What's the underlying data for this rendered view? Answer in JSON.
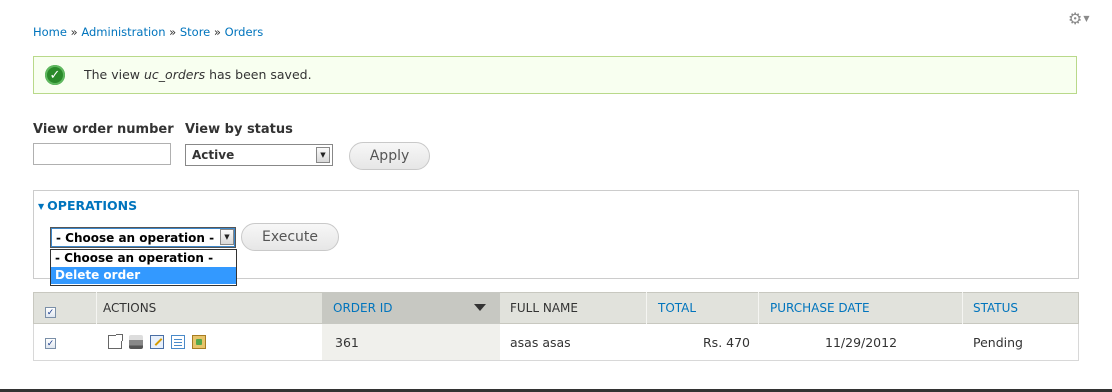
{
  "breadcrumb": {
    "items": [
      "Home",
      "Administration",
      "Store",
      "Orders"
    ],
    "separator": "»"
  },
  "message": {
    "prefix": "The view",
    "view_name": "uc_orders",
    "suffix": "has been saved.",
    "icon": "check-icon"
  },
  "filters": {
    "order_number_label": "View order number",
    "order_number_value": "",
    "status_label": "View by status",
    "status_selected": "Active",
    "apply_label": "Apply"
  },
  "operations": {
    "legend": "OPERATIONS",
    "select_selected": "- Choose an operation -",
    "options": [
      "- Choose an operation -",
      "Delete order"
    ],
    "highlighted_option": "Delete order",
    "execute_label": "Execute"
  },
  "table": {
    "headers": {
      "actions": "ACTIONS",
      "order_id": "ORDER ID",
      "full_name": "FULL NAME",
      "total": "TOTAL",
      "purchase_date": "PURCHASE DATE",
      "status": "STATUS"
    },
    "sorted_column": "order_id",
    "sort_direction": "desc",
    "rows": [
      {
        "checked": true,
        "action_icons": [
          "view-icon",
          "print-icon",
          "edit-icon",
          "invoice-icon",
          "ship-icon"
        ],
        "order_id": "361",
        "full_name": "asas asas",
        "total": "Rs. 470",
        "purchase_date": "11/29/2012",
        "status": "Pending"
      }
    ]
  },
  "colors": {
    "link": "#0074bd",
    "success_bg": "#f8fff0",
    "success_border": "#b9d98a",
    "header_bg": "#e1e2dc",
    "sorted_header_bg": "#c7c8c2",
    "option_highlight": "#3399ff"
  }
}
